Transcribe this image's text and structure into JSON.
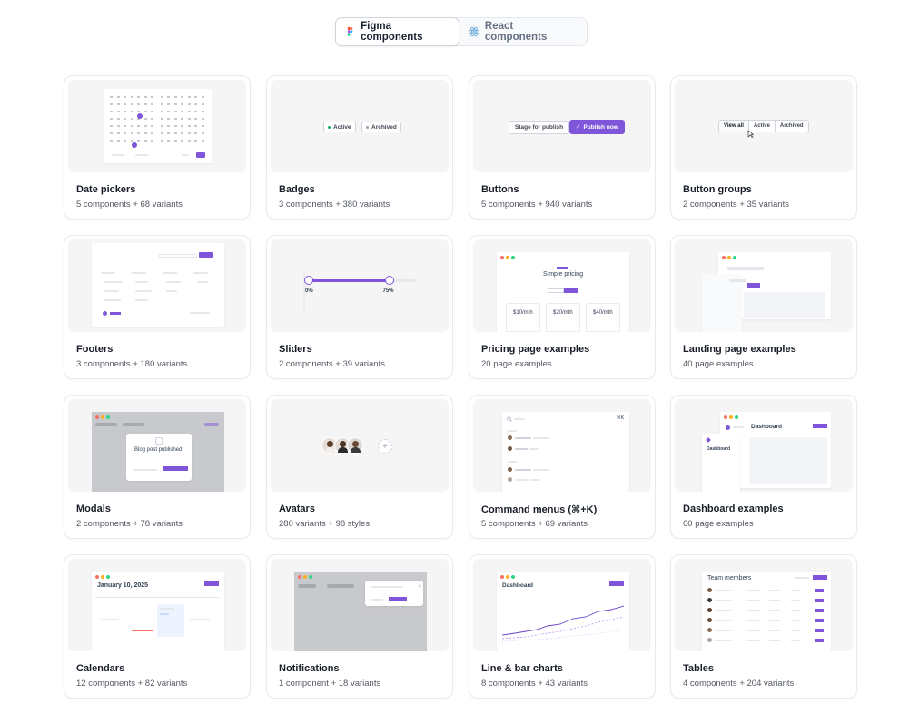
{
  "tabs": [
    {
      "label": "Figma components",
      "icon": "figma-icon",
      "active": true
    },
    {
      "label": "React components",
      "icon": "react-icon",
      "active": false
    }
  ],
  "colors": {
    "accent": "#7f56d9",
    "border": "#e9eaeb",
    "thumb_bg": "#f5f5f6"
  },
  "cards": [
    {
      "title": "Date pickers",
      "subtitle": "5 components + 68 variants"
    },
    {
      "title": "Badges",
      "subtitle": "3 components + 380 variants"
    },
    {
      "title": "Buttons",
      "subtitle": "5 components + 940 variants"
    },
    {
      "title": "Button groups",
      "subtitle": "2 components + 35 variants"
    },
    {
      "title": "Footers",
      "subtitle": "3 components + 180 variants"
    },
    {
      "title": "Sliders",
      "subtitle": "2 components + 39 variants"
    },
    {
      "title": "Pricing page examples",
      "subtitle": "20 page examples"
    },
    {
      "title": "Landing page examples",
      "subtitle": "40 page examples"
    },
    {
      "title": "Modals",
      "subtitle": "2 components + 78 variants"
    },
    {
      "title": "Avatars",
      "subtitle": "280 variants + 98 styles"
    },
    {
      "title": "Command menus (⌘+K)",
      "subtitle": "5 components + 69 variants"
    },
    {
      "title": "Dashboard examples",
      "subtitle": "60 page examples"
    },
    {
      "title": "Calendars",
      "subtitle": "12 components + 82 variants"
    },
    {
      "title": "Notifications",
      "subtitle": "1 component + 18 variants"
    },
    {
      "title": "Line & bar charts",
      "subtitle": "8 components + 43 variants"
    },
    {
      "title": "Tables",
      "subtitle": "4 components + 204 variants"
    }
  ],
  "previews": {
    "badges": {
      "active": "Active",
      "archived": "Archived"
    },
    "buttons": {
      "secondary": "Stage for publish",
      "primary": "Publish now",
      "check": "✓"
    },
    "button_groups": {
      "items": [
        "View all",
        "Active",
        "Archived"
      ]
    },
    "sliders": {
      "min_label": "0%",
      "max_label": "75%",
      "low_fraction": 0.0,
      "high_fraction": 0.75
    },
    "pricing": {
      "heading": "Simple pricing",
      "prices": [
        "$10/mth",
        "$20/mth",
        "$40/mth"
      ]
    },
    "modals": {
      "heading": "Blog post published"
    },
    "command": {
      "shortcut": "⌘K"
    },
    "dashboard": {
      "heading": "Dashboard",
      "sub": "Dashboard"
    },
    "calendars": {
      "heading": "January 10, 2025"
    },
    "charts": {
      "heading": "Dashboard"
    },
    "tables": {
      "heading": "Team members"
    },
    "avatars": {
      "add": "+"
    }
  }
}
